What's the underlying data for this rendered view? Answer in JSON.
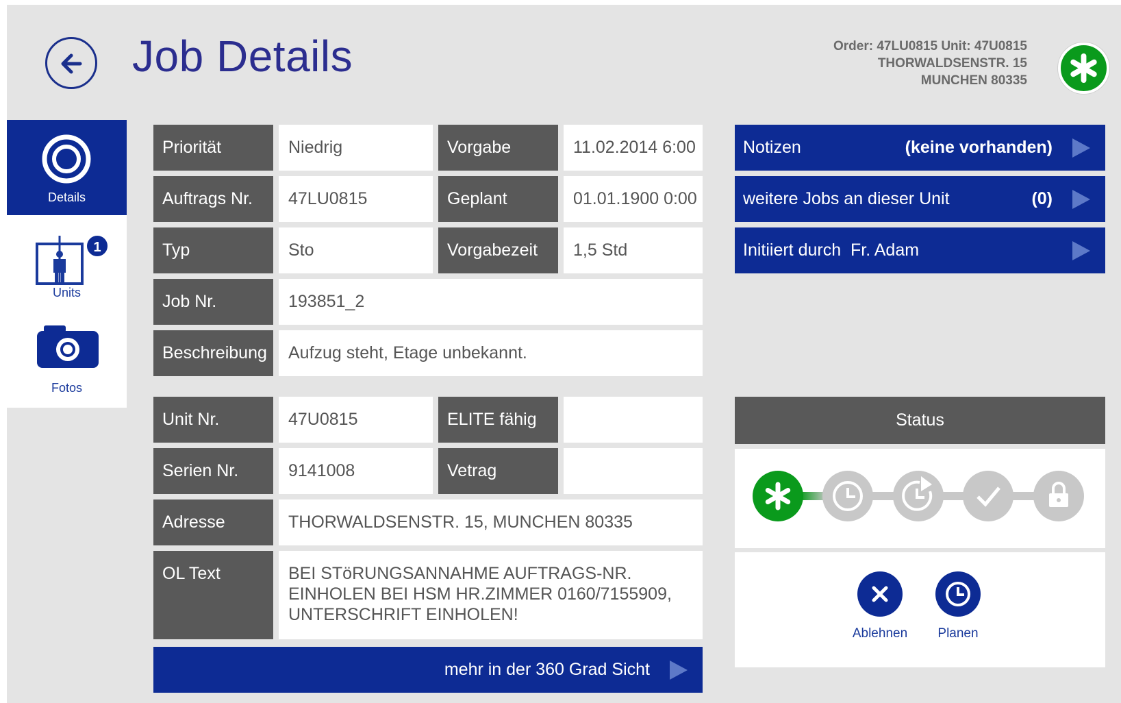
{
  "header": {
    "title": "Job Details",
    "order_line": "Order: 47LU0815 Unit: 47U0815",
    "address_line1": "THORWALDSENSTR. 15",
    "address_line2": "MUNCHEN 80335"
  },
  "sidebar": {
    "items": [
      {
        "label": "Details",
        "icon": "target-icon",
        "active": true
      },
      {
        "label": "Units",
        "icon": "elevator-icon",
        "badge": "1"
      },
      {
        "label": "Fotos",
        "icon": "camera-icon"
      }
    ]
  },
  "fields": {
    "prioritaet": {
      "label": "Priorität",
      "value": "Niedrig"
    },
    "vorgabe": {
      "label": "Vorgabe",
      "value": "11.02.2014 6:00"
    },
    "auftrags_nr": {
      "label": "Auftrags Nr.",
      "value": "47LU0815"
    },
    "geplant": {
      "label": "Geplant",
      "value": "01.01.1900 0:00"
    },
    "typ": {
      "label": "Typ",
      "value": "Sto"
    },
    "vorgabezeit": {
      "label": "Vorgabezeit",
      "value": "1,5 Std"
    },
    "job_nr": {
      "label": "Job Nr.",
      "value": "193851_2"
    },
    "beschreibung": {
      "label": "Beschreibung",
      "value": "Aufzug steht, Etage unbekannt."
    },
    "unit_nr": {
      "label": "Unit Nr.",
      "value": "47U0815"
    },
    "elite": {
      "label": "ELITE fähig",
      "value": ""
    },
    "serien_nr": {
      "label": "Serien Nr.",
      "value": "9141008"
    },
    "vetrag": {
      "label": "Vetrag",
      "value": ""
    },
    "adresse": {
      "label": "Adresse",
      "value": "THORWALDSENSTR. 15, MUNCHEN 80335"
    },
    "ol_text": {
      "label": "OL Text",
      "value": "BEI STöRUNGSANNAHME AUFTRAGS-NR. EINHOLEN BEI HSM HR.ZIMMER 0160/7155909, UNTERSCHRIFT EINHOLEN!"
    }
  },
  "more_button": {
    "label": "mehr in der 360 Grad Sicht"
  },
  "side_links": {
    "notizen": {
      "label": "Notizen",
      "value": "(keine vorhanden)"
    },
    "weitere_jobs": {
      "label": "weitere Jobs an dieser Unit",
      "value": "(0)"
    },
    "initiiert": {
      "label": "Initiiert durch",
      "value": "Fr. Adam"
    }
  },
  "status": {
    "title": "Status",
    "steps": [
      "new",
      "clock",
      "started",
      "done",
      "locked"
    ],
    "current_step": 0,
    "actions": [
      {
        "label": "Ablehnen",
        "icon": "close-icon"
      },
      {
        "label": "Planen",
        "icon": "clock-icon"
      }
    ]
  },
  "colors": {
    "brand_blue": "#0d2b94",
    "label_gray": "#595959",
    "status_green": "#0a9a1c"
  }
}
